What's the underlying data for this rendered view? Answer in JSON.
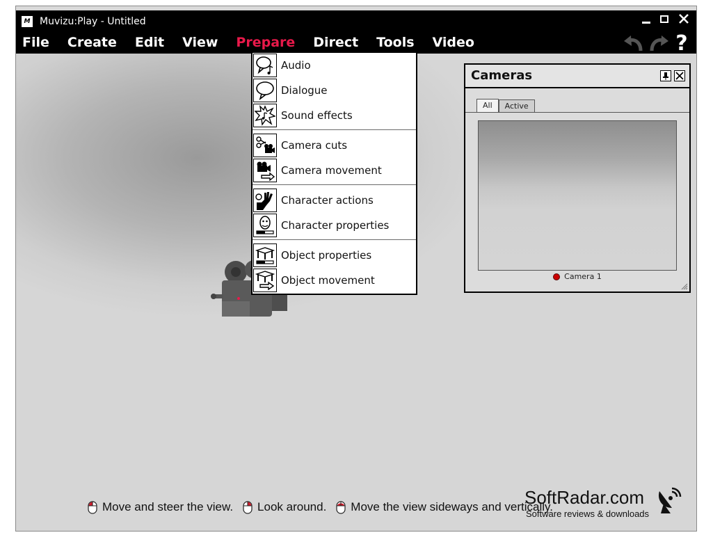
{
  "titlebar": {
    "app_icon": "M",
    "title": "Muvizu:Play - Untitled"
  },
  "menubar": {
    "items": [
      "File",
      "Create",
      "Edit",
      "View",
      "Prepare",
      "Direct",
      "Tools",
      "Video"
    ],
    "active_item": "Prepare",
    "active_color": "#e8194a",
    "help_label": "?"
  },
  "prepare_menu": {
    "items": [
      {
        "label": "Audio",
        "icon": "audio-speech-bubble-icon"
      },
      {
        "label": "Dialogue",
        "icon": "dialogue-speech-bubble-icon"
      },
      {
        "label": "Sound effects",
        "icon": "sound-effects-burst-icon"
      },
      {
        "label": "Camera cuts",
        "icon": "camera-cuts-scissors-icon"
      },
      {
        "label": "Camera movement",
        "icon": "camera-movement-icon"
      },
      {
        "label": "Character actions",
        "icon": "character-actions-hand-icon"
      },
      {
        "label": "Character properties",
        "icon": "character-properties-face-icon"
      },
      {
        "label": "Object properties",
        "icon": "object-properties-table-icon"
      },
      {
        "label": "Object movement",
        "icon": "object-movement-table-icon"
      }
    ]
  },
  "cameras_panel": {
    "title": "Cameras",
    "tabs": [
      "All",
      "Active"
    ],
    "selected_tab": "All",
    "camera_name": "Camera 1",
    "camera_dot_color": "#cc0000"
  },
  "hints": [
    "Move and steer the view.",
    "Look around.",
    "Move the view sideways and vertically."
  ],
  "watermark": {
    "title": "SoftRadar.com",
    "subtitle": "Software reviews & downloads"
  }
}
